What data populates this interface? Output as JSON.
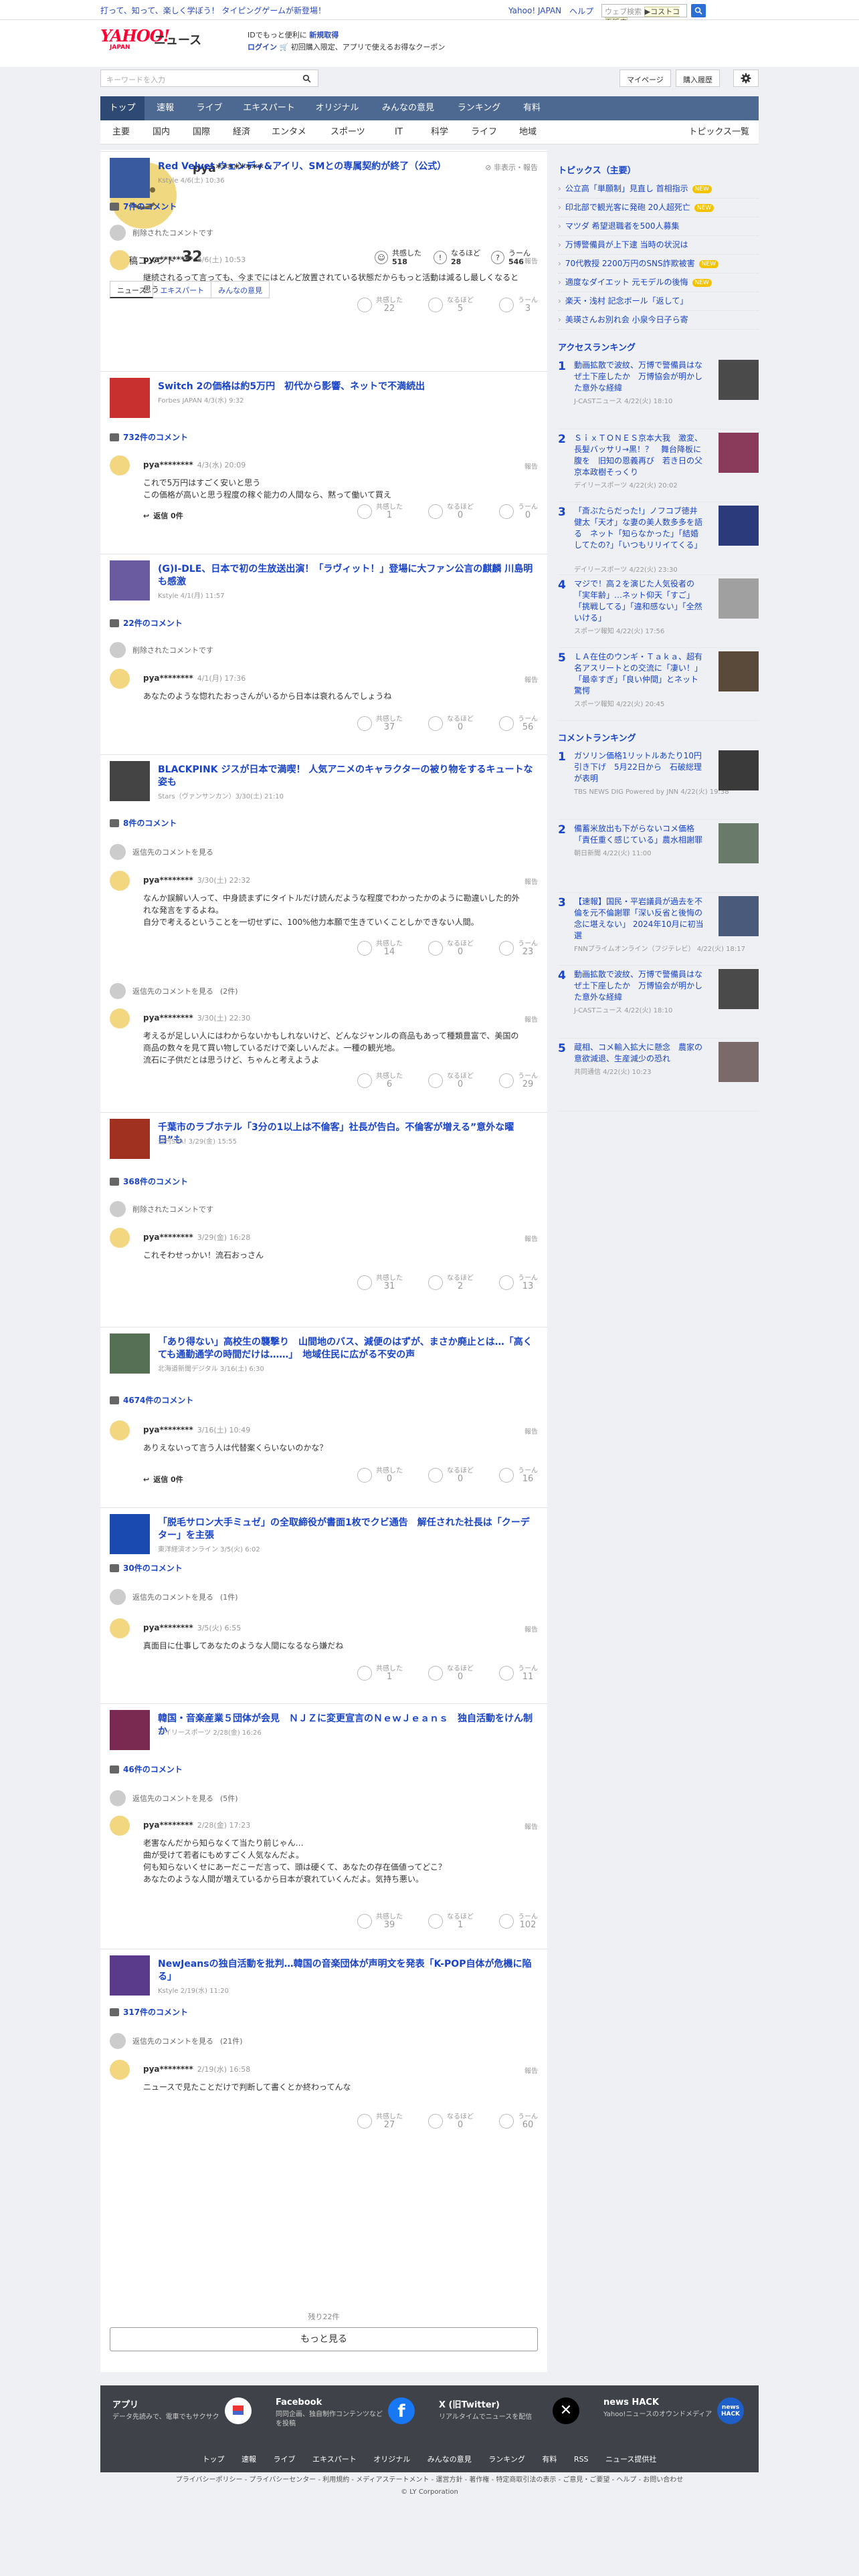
{
  "top": {
    "promo": "打って、知って、楽しく学ぼう！ タイピングゲームが新登場！",
    "links": [
      "Yahoo! JAPAN",
      "ヘルプ"
    ],
    "search_placeholder": "ウェブ検索",
    "store": "▶コストコ再販店"
  },
  "header": {
    "logo": "YAHOO!",
    "logo_sub": "JAPAN",
    "news": "ニュース",
    "promo1a": "IDでもっと便利に",
    "promo1b": "新規取得",
    "promo2a": "ログイン",
    "promo2b": "🛒 初回購入限定、アプリで使えるお得なクーポン"
  },
  "toolbar": {
    "placeholder": "キーワードを入力",
    "mypage": "マイページ",
    "history": "購入履歴"
  },
  "nav1": [
    "トップ",
    "速報",
    "ライブ",
    "エキスパート",
    "オリジナル",
    "みんなの意見",
    "ランキング",
    "有料"
  ],
  "nav2": [
    "主要",
    "国内",
    "国際",
    "経済",
    "エンタメ",
    "スポーツ",
    "IT",
    "科学",
    "ライフ",
    "地域"
  ],
  "nav2_right": "トピックス一覧",
  "profile": {
    "name": "pya********",
    "meta": "非表示・報告",
    "comments_label": "投稿コメント",
    "comments_count": "32",
    "reactions": [
      {
        "label": "共感した",
        "value": "518"
      },
      {
        "label": "なるほど",
        "value": "28"
      },
      {
        "label": "うーん",
        "value": "546"
      }
    ]
  },
  "tabs": [
    "ニュース",
    "エキスパート",
    "みんなの意見"
  ],
  "labels": {
    "deleted": "削除されたコメントです",
    "replies_src": "返信先のコメントを見る",
    "reply": "返信 0件",
    "report": "報告",
    "agree": "共感した",
    "hmm": "なるほど",
    "uun": "うーん",
    "more": "もっと見る",
    "remaining": "残り22件"
  },
  "articles": [
    {
      "title": "Red Velvet ウェンディ&アイリ、SMとの専属契約が終了（公式）",
      "src": "Kstyle 4/6(土) 10:36",
      "count": "7件のコメント",
      "comment": {
        "user": "pya********",
        "date": "4/6(土) 10:53",
        "text": "継続されるって言っても、今までにはとんど放置されている状態だからもっと活動は減るし最しくなると思う",
        "r": [
          "22",
          "5",
          "3"
        ]
      }
    },
    {
      "title": "Switch 2の価格は約5万円　初代から影響、ネットで不満続出",
      "src": "Forbes JAPAN 4/3(水) 9:32",
      "count": "732件のコメント",
      "comment": {
        "user": "pya********",
        "date": "4/3(水) 20:09",
        "text": "これで5万円はすごく安いと思う\nこの価格が高いと思う程度の稼ぐ能力の人間なら、黙って働いて買え",
        "r": [
          "1",
          "0",
          "0"
        ]
      }
    },
    {
      "title": "(G)I-DLE、日本で初の生放送出演！「ラヴィット！」登場に大ファン公言の麒麟 川島明も感激",
      "src": "Kstyle 4/1(月) 11:57",
      "count": "22件のコメント",
      "comment": {
        "user": "pya********",
        "date": "4/1(月) 17:36",
        "text": "あなたのような惚れたおっさんがいるから日本は衰れるんでしょうね",
        "r": [
          "37",
          "0",
          "56"
        ]
      }
    },
    {
      "title": "BLACKPINK ジスが日本で満喫！ 人気アニメのキャラクターの被り物をするキュートな姿も",
      "src": "Stars（ヴァンサンカン）3/30(土) 21:10",
      "count": "8件のコメント",
      "comment": {
        "user": "pya********",
        "date": "3/30(土) 22:32",
        "text": "なんか誤解い人って、中身読まずにタイトルだけ読んだような程度でわかったかのように勘違いした的外れな発言をするよね。\n自分で考えるということを一切せずに、100%他力本願で生きていくことしかできない人間。",
        "r": [
          "14",
          "0",
          "23"
        ]
      },
      "comment2": {
        "user": "pya********",
        "date": "3/30(土) 22:30",
        "text": "考えるが足しい人にはわからないかもしれないけど、どんなジャンルの商品もあって種類豊富で、美国の商品の数々を見て買い物しているだけで楽しいんだよ。一種の観光地。\n流石に子供だとは思うけど、ちゃんと考えようよ",
        "r": [
          "6",
          "0",
          "29"
        ]
      }
    },
    {
      "title": "千葉市のラブホテル「3分の1以上は不倫客」社長が告白。不倫客が増える”意外な曜日”も",
      "src": "週刊SPA! 3/29(金) 15:55",
      "count": "368件のコメント",
      "comment": {
        "user": "pya********",
        "date": "3/29(金) 16:28",
        "text": "これそわせっかい！流石おっさん",
        "r": [
          "31",
          "2",
          "13"
        ]
      }
    },
    {
      "title": "「あり得ない」高校生の襲撃り　山間地のバス、減便のはずが、まさか廃止とは…「高くても通勤通学の時間だけは……」　地域住民に広がる不安の声",
      "src": "北海道新聞デジタル 3/16(土) 6:30",
      "count": "4674件のコメント",
      "comment": {
        "user": "pya********",
        "date": "3/16(土) 10:49",
        "text": "ありえないって言う人は代替案くらいないのかな？",
        "r": [
          "0",
          "0",
          "16"
        ]
      }
    },
    {
      "title": "「脱毛サロン大手ミュゼ」の全取締役が書面1枚でクビ通告　解任された社長は「クーデター」を主張",
      "src": "東洋経済オンライン 3/5(火) 6:02",
      "count": "30件のコメント",
      "comment": {
        "user": "pya********",
        "date": "3/5(火) 6:55",
        "text": "真面目に仕事してあなたのような人間になるなら嫌だね",
        "r": [
          "1",
          "0",
          "11"
        ]
      }
    },
    {
      "title": "韓国・音楽産業５団体が会見　ＮＪＺに変更宣言のＮｅｗＪｅａｎｓ　独自活動をけん制か",
      "src": "デイリースポーツ 2/28(金) 16:26",
      "count": "46件のコメント",
      "comment": {
        "user": "pya********",
        "date": "2/28(金) 17:23",
        "text": "老害なんだから知らなくて当たり前じゃん…\n曲が受けて若者にもめすごく人気なんだよ。\n何も知らないくせにあーだこーだ言って、頭は硬くて、あなたの存在価値ってどこ？\nあなたのような人間が増えているから日本が衰れていくんだよ。気持ち悪い。",
        "r": [
          "39",
          "1",
          "102"
        ]
      }
    },
    {
      "title": "NewJeansの独自活動を批判…韓国の音楽団体が声明文を発表「K-POP自体が危機に陥る」",
      "src": "Kstyle 2/19(水) 11:20",
      "count": "317件のコメント",
      "comment": {
        "user": "pya********",
        "date": "2/19(水) 16:58",
        "text": "ニュースで見たことだけで判断して書くとか終わってんな",
        "r": [
          "27",
          "0",
          "60"
        ]
      }
    }
  ],
  "sidebar": {
    "topics_title": "トピックス（主要）",
    "topics": [
      {
        "t": "公立高「単願制」見直し 首相指示",
        "n": true
      },
      {
        "t": "印北部で観光客に発砲 20人超死亡",
        "n": true
      },
      {
        "t": "マツダ 希望退職者を500人募集",
        "n": false
      },
      {
        "t": "万博警備員が上下逮 当時の状況は",
        "n": false
      },
      {
        "t": "70代教授 2200万円のSNS詐欺被害",
        "n": true
      },
      {
        "t": "適度なダイエット 元モデルの後悔",
        "n": true
      },
      {
        "t": "楽天・浅村 記念ボール「返して」",
        "n": false
      },
      {
        "t": "美瑛さんお別れ会 小泉今日子ら寄",
        "n": false
      }
    ],
    "access_title": "アクセスランキング",
    "access": [
      {
        "t": "動画拡散で波紋、万博で警備員はなぜ土下座したか　万博協会が明かした意外な経緯",
        "s": "J-CASTニュース 4/22(火) 18:10"
      },
      {
        "t": "ＳｉｘＴＯＮＥＳ京本大我　激変、長髪バッサリ→黒！？　舞台降板に腹を　旧知の恩義再び　若き日の父京本政樹そっくり",
        "s": "デイリースポーツ 4/22(火) 20:02"
      },
      {
        "t": "「斎ぶたらだった!」ノフコブ徳井健太「天才」な妻の美人数多多を語る　ネット「知らなかった」「結婚してたの?」「いつもリリイてくる」",
        "s": "デイリースポーツ 4/22(火) 23:30"
      },
      {
        "t": "マジで！高２を演じた人気役者の「実年齢」…ネット仰天「すご」「挑戦してる」「違和感ない」「全然いける」",
        "s": "スポーツ報知 4/22(火) 17:56"
      },
      {
        "t": "ＬＡ在住のウンギ・Ｔａｋａ、超有名アスリートとの交流に「凄い！」「最幸すぎ」「良い仲間」とネット驚愕",
        "s": "スポーツ報知 4/22(火) 20:45"
      }
    ],
    "comment_title": "コメントランキング",
    "commentrank": [
      {
        "t": "ガソリン価格1リットルあたり10円引き下げ　5月22日から　石破総理が表明",
        "s": "TBS NEWS DIG Powered by JNN 4/22(火) 19:38"
      },
      {
        "t": "備蓄米放出も下がらないコメ価格「責任重く感じている」農水相謝罪",
        "s": "朝日新聞 4/22(火) 11:00"
      },
      {
        "t": "【速報】国民・平岩議員が過去を不倫を元不倫謝罪「深い反省と後悔の念に堪えない」 2024年10月に初当選",
        "s": "FNNプライムオンライン（フジテレビ） 4/22(火) 18:17"
      },
      {
        "t": "動画拡散で波紋、万博で警備員はなぜ土下座したか　万博協会が明かした意外な経緯",
        "s": "J-CASTニュース 4/22(火) 18:10"
      },
      {
        "t": "蔵相、コメ輸入拡大に懸念　農家の意欲減退、生産減少の恐れ",
        "s": "共同通信 4/22(火) 10:23"
      }
    ]
  },
  "footer": {
    "cols": [
      {
        "h": "アプリ",
        "d": "データ先読みで、電車でもサクサク"
      },
      {
        "h": "Facebook",
        "d": "同同企画、独自制作コンテンツなどを投稿"
      },
      {
        "h": "X (旧Twitter)",
        "d": "リアルタイムでニュースを配信"
      },
      {
        "h": "news HACK",
        "d": "Yahoo!ニュースのオウンドメディア"
      }
    ],
    "nav": "トップ 速報 ライブ エキスパート オリジナル みんなの意見 ランキング 有料 RSS ニュース提供社",
    "legal1": "プライバシーポリシー - プライバシーセンター - 利用規約 - メディアステートメント - 運営方針 - 著作権 - 特定商取引法の表示 - ご意見・ご要望 - ヘルプ - お問い合わせ",
    "legal2": "© LY Corporation"
  },
  "colors": {
    "link": "#1a44c7",
    "nav": "#4d6891",
    "new_badge": "#f4c300",
    "footer": "#3f4349"
  }
}
